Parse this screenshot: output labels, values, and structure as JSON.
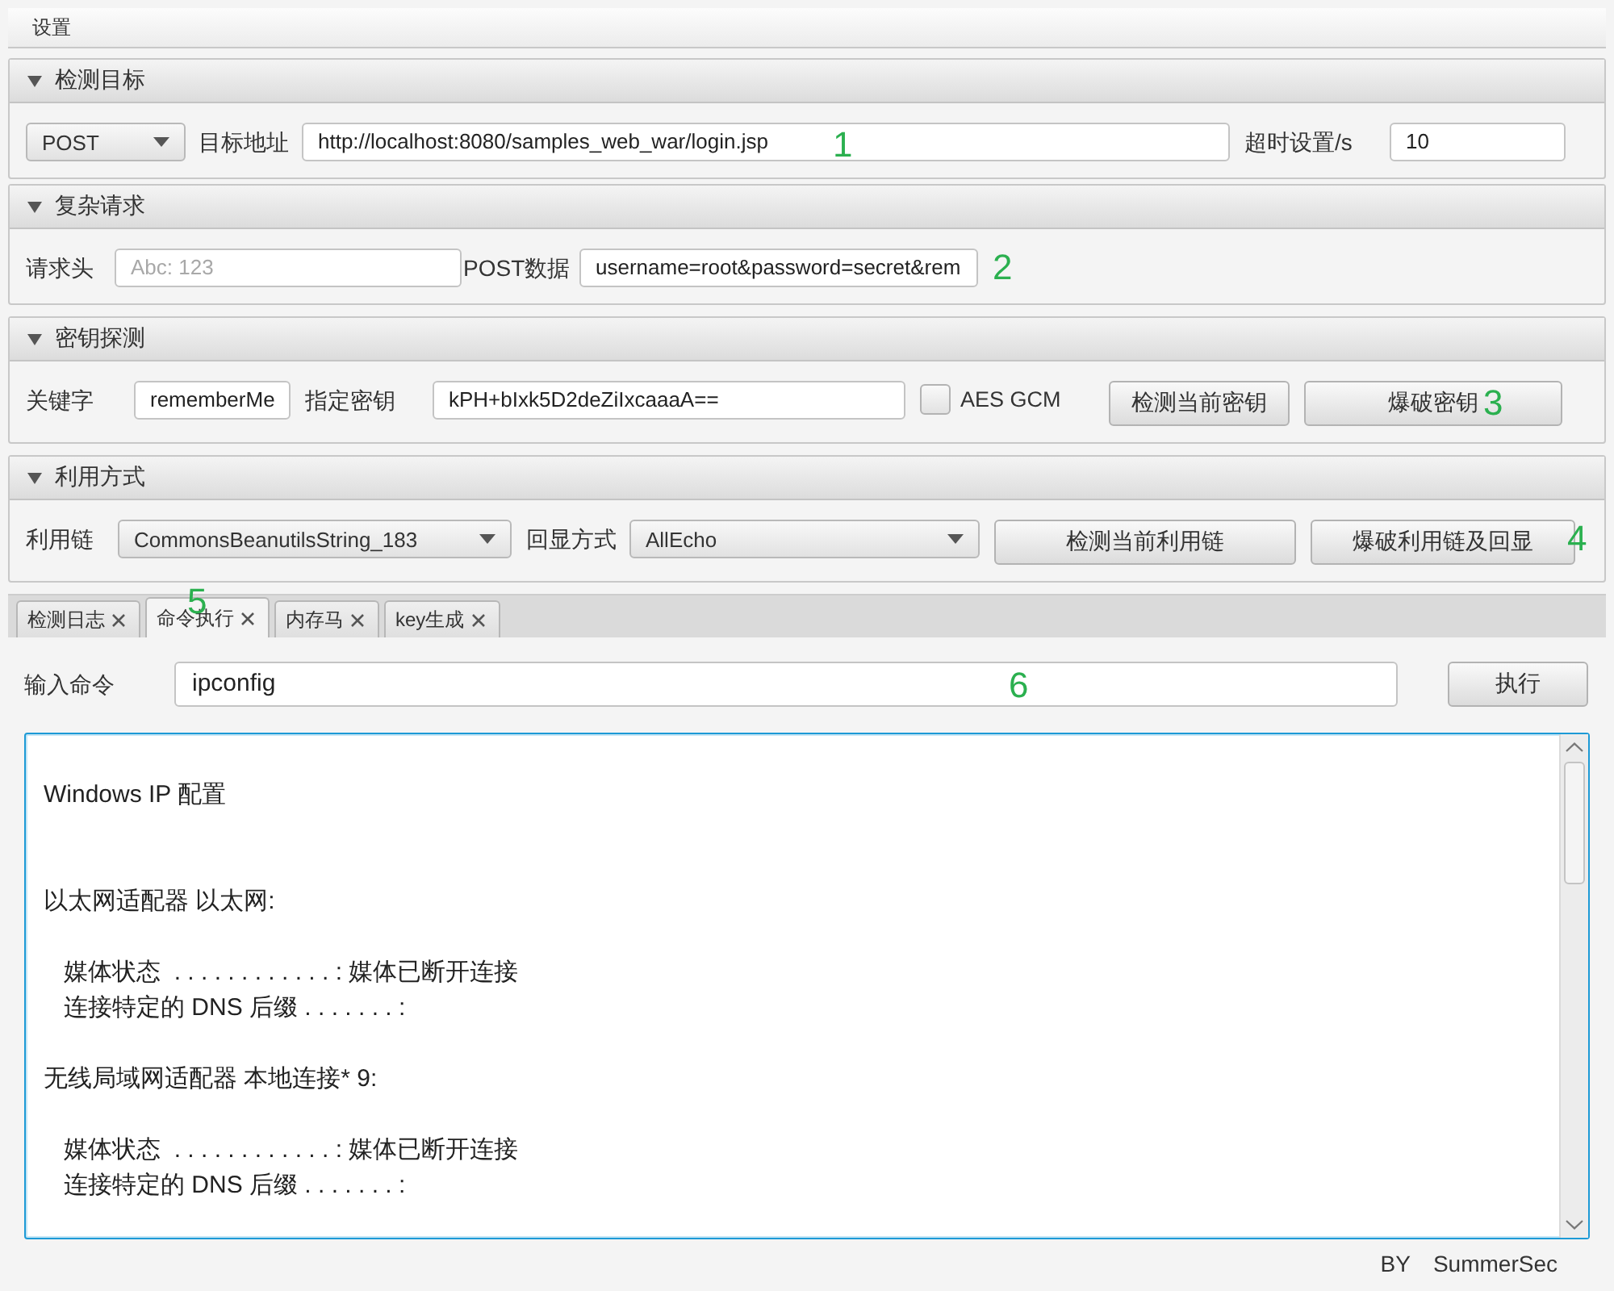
{
  "menu_bar": {
    "items": [
      {
        "label": "设置"
      }
    ]
  },
  "target": {
    "title": "检测目标",
    "expanded": true,
    "method": {
      "value": "POST"
    },
    "url": {
      "label": "目标地址",
      "value": "http://localhost:8080/samples_web_war/login.jsp",
      "annotation": "1"
    },
    "timeout": {
      "label": "超时设置/s",
      "value": "10"
    }
  },
  "request": {
    "title": "复杂请求",
    "expanded": true,
    "headers": {
      "label": "请求头",
      "placeholder": "Abc: 123"
    },
    "post_data": {
      "label": "POST数据",
      "value": "username=root&password=secret&rem",
      "annotation": "2"
    }
  },
  "key_detect": {
    "title": "密钥探测",
    "expanded": true,
    "keyword": {
      "label": "关键字",
      "value": "rememberMe"
    },
    "key": {
      "label": "指定密钥",
      "value": "kPH+bIxk5D2deZiIxcaaaA=="
    },
    "aes_gcm": {
      "label": "AES GCM",
      "checked": false
    },
    "buttons": [
      {
        "label": "检测当前密钥"
      },
      {
        "label": "爆破密钥",
        "annotation": "3"
      }
    ]
  },
  "exploit": {
    "title": "利用方式",
    "expanded": true,
    "chain": {
      "label": "利用链",
      "value": "CommonsBeanutilsString_183"
    },
    "echo": {
      "label": "回显方式",
      "value": "AllEcho"
    },
    "buttons": [
      {
        "label": "检测当前利用链"
      },
      {
        "label": "爆破利用链及回显",
        "annotation": "4"
      }
    ]
  },
  "tabs": [
    {
      "label": "检测日志",
      "selected": false
    },
    {
      "label": "命令执行",
      "selected": true,
      "annotation": "5"
    },
    {
      "label": "内存马",
      "selected": false
    },
    {
      "label": "key生成",
      "selected": false
    }
  ],
  "command": {
    "label": "输入命令",
    "value": "ipconfig",
    "annotation": "6",
    "button": "执行"
  },
  "output": {
    "blocks": [
      [
        "Windows IP 配置"
      ],
      [
        "以太网适配器 以太网:"
      ],
      [
        "   媒体状态  . . . . . . . . . . . . : 媒体已断开连接",
        "   连接特定的 DNS 后缀 . . . . . . . :"
      ],
      [
        "无线局域网适配器 本地连接* 9:"
      ],
      [
        "   媒体状态  . . . . . . . . . . . . : 媒体已断开连接",
        "   连接特定的 DNS 后缀 . . . . . . . :"
      ]
    ]
  },
  "footer": {
    "by": "BY",
    "author": "SummerSec"
  }
}
